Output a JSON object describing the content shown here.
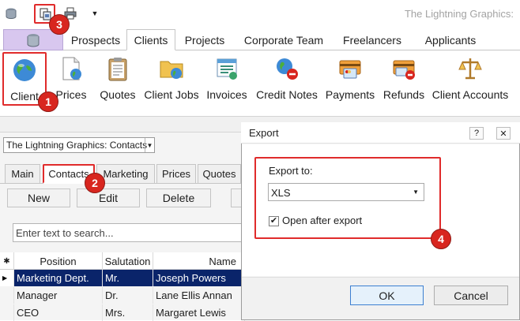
{
  "app": {
    "title": "The Lightning Graphics:"
  },
  "quick_access": {
    "items": [
      "db-icon",
      "print-preview-icon",
      "print-icon",
      "customize-dropdown-icon"
    ]
  },
  "tabs": [
    "Prospects",
    "Clients",
    "Projects",
    "Corporate Team",
    "Freelancers",
    "Applicants"
  ],
  "active_tab": "Clients",
  "ribbon": {
    "buttons": [
      "Client",
      "Prices",
      "Quotes",
      "Client Jobs",
      "Invoices",
      "Credit Notes",
      "Payments",
      "Refunds",
      "Client Accounts"
    ]
  },
  "record_selector": {
    "value": "The Lightning Graphics: Contacts"
  },
  "subtabs": [
    "Main",
    "Contacts",
    "Marketing",
    "Prices",
    "Quotes"
  ],
  "active_subtab": "Contacts",
  "toolbar": {
    "new_label": "New",
    "edit_label": "Edit",
    "delete_label": "Delete"
  },
  "search": {
    "placeholder": "Enter text to search..."
  },
  "grid": {
    "marker": "✱",
    "columns": [
      "Position",
      "Salutation",
      "Name"
    ],
    "rows": [
      [
        "Marketing Dept.",
        "Mr.",
        "Joseph Powers"
      ],
      [
        "Manager",
        "Dr.",
        "Lane Ellis Annan"
      ],
      [
        "CEO",
        "Mrs.",
        "Margaret Lewis"
      ]
    ]
  },
  "dialog": {
    "title": "Export",
    "help_label": "?",
    "close_label": "✕",
    "export_to_label": "Export to:",
    "export_format": "XLS",
    "open_after_label": "Open after export",
    "open_after_checked": true,
    "ok_label": "OK",
    "cancel_label": "Cancel"
  },
  "callouts": [
    "1",
    "2",
    "3",
    "4"
  ],
  "colors": {
    "accent": "#0a246a",
    "callout": "#d8261f",
    "app_tab": "#d8c7ef"
  }
}
